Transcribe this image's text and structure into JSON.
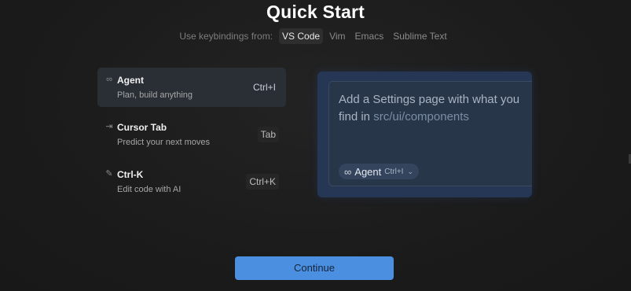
{
  "title": "Quick Start",
  "keybindings": {
    "label": "Use keybindings from:",
    "options": [
      {
        "label": "VS Code",
        "active": true
      },
      {
        "label": "Vim",
        "active": false
      },
      {
        "label": "Emacs",
        "active": false
      },
      {
        "label": "Sublime Text",
        "active": false
      }
    ]
  },
  "features": [
    {
      "icon": "infinity-icon",
      "glyph": "∞",
      "name": "Agent",
      "desc": "Plan, build anything",
      "key": "Ctrl+I",
      "active": true
    },
    {
      "icon": "tab-arrow-icon",
      "glyph": "⇥",
      "name": "Cursor Tab",
      "desc": "Predict your next moves",
      "key": "Tab",
      "active": false
    },
    {
      "icon": "pencil-icon",
      "glyph": "✎",
      "name": "Ctrl-K",
      "desc": "Edit code with AI",
      "key": "Ctrl+K",
      "active": false
    }
  ],
  "preview": {
    "prompt_text": "Add a Settings page with what you find in ",
    "prompt_path": "src/ui/components",
    "chip_icon": "∞",
    "chip_label": "Agent",
    "chip_key": "Ctrl+I",
    "chip_chevron": "⌄"
  },
  "continue_label": "Continue",
  "colors": {
    "accent": "#4a8fe0",
    "preview_bg": "#253754"
  }
}
